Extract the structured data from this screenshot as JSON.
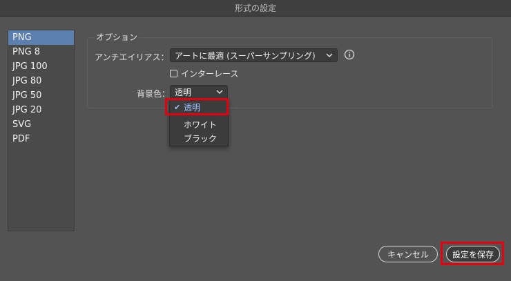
{
  "window": {
    "title": "形式の設定"
  },
  "sidebar": {
    "items": [
      {
        "label": "PNG",
        "selected": true
      },
      {
        "label": "PNG 8"
      },
      {
        "label": "JPG 100"
      },
      {
        "label": "JPG 80"
      },
      {
        "label": "JPG 50"
      },
      {
        "label": "JPG 20"
      },
      {
        "label": "SVG"
      },
      {
        "label": "PDF"
      }
    ]
  },
  "options": {
    "group_title": "オプション",
    "antialias": {
      "label": "アンチエイリアス：",
      "value": "アートに最適 (スーパーサンプリング)"
    },
    "interlace": {
      "label": "インターレース",
      "checked": false
    },
    "background": {
      "label": "背景色：",
      "value": "透明",
      "options": [
        "透明",
        "ホワイト",
        "ブラック"
      ],
      "selected_index": 0
    }
  },
  "buttons": {
    "cancel": "キャンセル",
    "save": "設定を保存"
  },
  "colors": {
    "accent": "#5b7fae",
    "highlight": "#e8000d",
    "background": "#535353"
  }
}
